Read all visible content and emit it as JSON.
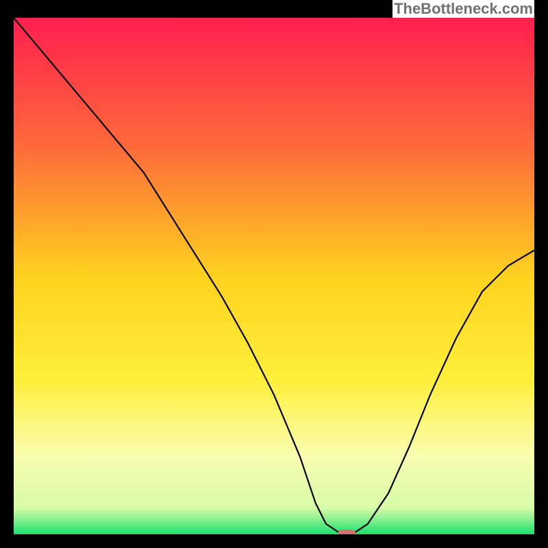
{
  "watermark": "TheBottleneck.com",
  "chart_data": {
    "type": "line",
    "title": "",
    "xlabel": "",
    "ylabel": "",
    "xlim": [
      0,
      100
    ],
    "ylim": [
      0,
      100
    ],
    "gradient_stops": [
      {
        "offset": 0,
        "color": "#ff1f4f"
      },
      {
        "offset": 25,
        "color": "#ff6a3a"
      },
      {
        "offset": 50,
        "color": "#ffd21f"
      },
      {
        "offset": 70,
        "color": "#ffef3a"
      },
      {
        "offset": 85,
        "color": "#f9fdb0"
      },
      {
        "offset": 95,
        "color": "#d6fca8"
      },
      {
        "offset": 100,
        "color": "#19e06e"
      }
    ],
    "series": [
      {
        "name": "bottleneck-curve",
        "x": [
          0,
          5,
          10,
          15,
          20,
          25,
          30,
          35,
          40,
          45,
          50,
          55,
          58,
          60,
          63,
          65,
          68,
          72,
          76,
          80,
          85,
          90,
          95,
          100
        ],
        "y": [
          100,
          94,
          88,
          82,
          76,
          70,
          62,
          54,
          46,
          37,
          27,
          15,
          6,
          2,
          0,
          0,
          2,
          8,
          17,
          27,
          38,
          47,
          52,
          55
        ]
      }
    ],
    "marker": {
      "x": 64,
      "y": 0,
      "label": "optimal-point"
    }
  }
}
